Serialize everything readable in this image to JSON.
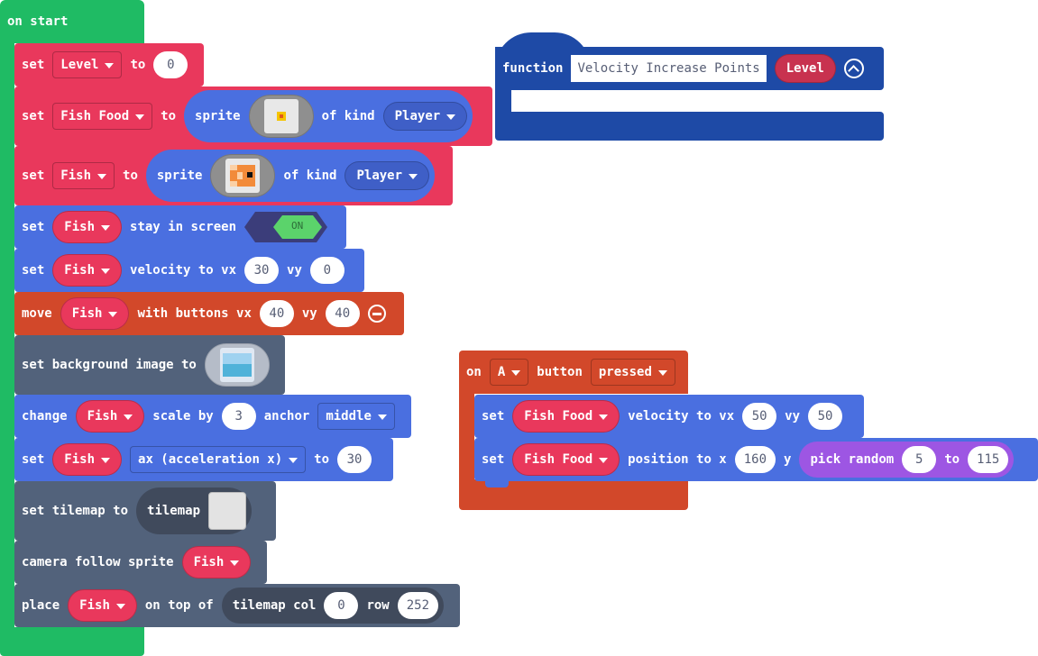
{
  "colors": {
    "green": "#1fbb64",
    "red": "#e9385c",
    "blue": "#4a6fe0",
    "dark": "#52627b",
    "orange": "#d2482a",
    "navy": "#1e4aa6",
    "purple": "#9d56e3"
  },
  "on_start": {
    "label": "on start",
    "set_level": {
      "set": "set",
      "var": "Level",
      "to": "to",
      "value": "0"
    },
    "set_fish_food": {
      "set": "set",
      "var": "Fish Food",
      "to": "to",
      "sprite": "sprite",
      "of_kind": "of kind",
      "kind": "Player"
    },
    "set_fish": {
      "set": "set",
      "var": "Fish",
      "to": "to",
      "sprite": "sprite",
      "of_kind": "of kind",
      "kind": "Player"
    },
    "stay_in_screen": {
      "set": "set",
      "var": "Fish",
      "text": "stay in screen",
      "toggle": "ON"
    },
    "velocity": {
      "set": "set",
      "var": "Fish",
      "text": "velocity to vx",
      "vx": "30",
      "vy_label": "vy",
      "vy": "0"
    },
    "move": {
      "move": "move",
      "var": "Fish",
      "text": "with buttons vx",
      "vx": "40",
      "vy_label": "vy",
      "vy": "40"
    },
    "background": {
      "text": "set background image to"
    },
    "scale": {
      "change": "change",
      "var": "Fish",
      "text": "scale by",
      "value": "3",
      "anchor_label": "anchor",
      "anchor": "middle"
    },
    "accel": {
      "set": "set",
      "var": "Fish",
      "prop": "ax (acceleration x)",
      "to": "to",
      "value": "30"
    },
    "tilemap": {
      "text": "set tilemap to",
      "reporter": "tilemap"
    },
    "camera": {
      "text": "camera follow sprite",
      "var": "Fish"
    },
    "place": {
      "place": "place",
      "var": "Fish",
      "text": "on top of",
      "reporter": "tilemap col",
      "col": "0",
      "row_label": "row",
      "row": "252"
    }
  },
  "function_block": {
    "keyword": "function",
    "name": "Velocity Increase Points",
    "param": "Level"
  },
  "on_button": {
    "on": "on",
    "button": "A",
    "button_label": "button",
    "event": "pressed",
    "velocity": {
      "set": "set",
      "var": "Fish Food",
      "text": "velocity to vx",
      "vx": "50",
      "vy_label": "vy",
      "vy": "50"
    },
    "position": {
      "set": "set",
      "var": "Fish Food",
      "text": "position to x",
      "x": "160",
      "y_label": "y",
      "random": "pick random",
      "from": "5",
      "to_label": "to",
      "to": "115"
    }
  }
}
